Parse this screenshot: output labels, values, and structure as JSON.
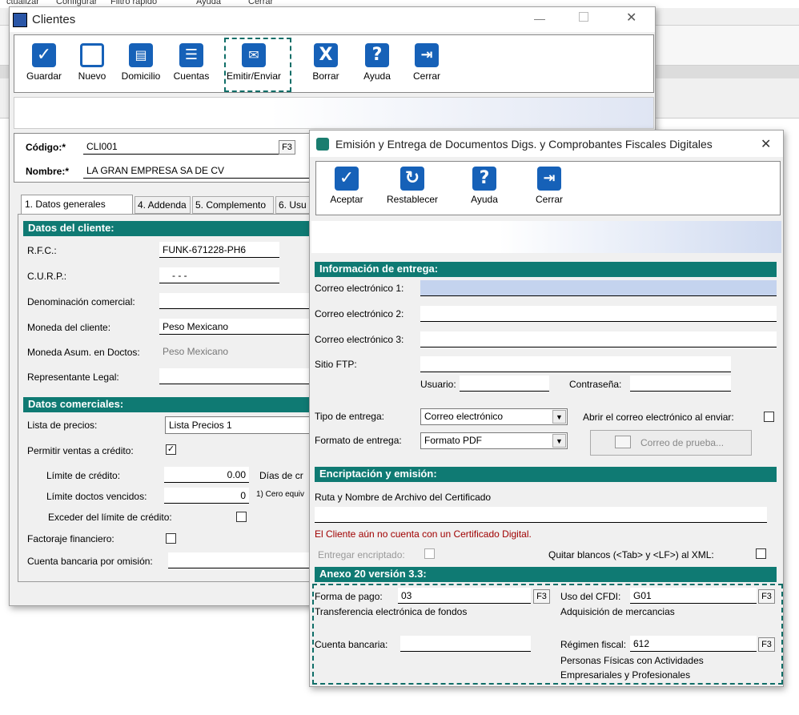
{
  "background": {
    "menu": [
      "ctualizar",
      "Configurar",
      "Filtro rápido",
      "Ayuda",
      "Cerrar"
    ]
  },
  "clientes": {
    "title": "Clientes",
    "toolbar": {
      "guardar": "Guardar",
      "nuevo": "Nuevo",
      "domicilio": "Domicilio",
      "cuentas": "Cuentas",
      "emitir": "Emitir/Enviar",
      "borrar": "Borrar",
      "ayuda": "Ayuda",
      "cerrar": "Cerrar"
    },
    "codigo_label": "Código:*",
    "codigo_value": "CLI001",
    "nombre_label": "Nombre:*",
    "nombre_value": "LA GRAN EMPRESA SA DE CV",
    "f3": "F3",
    "tabs": [
      "1. Datos generales",
      "4. Addenda",
      "5. Complemento",
      "6. Usu"
    ],
    "datos_cliente": {
      "header": "Datos del cliente:",
      "rfc_label": "R.F.C.:",
      "rfc_value": "FUNK-671228-PH6",
      "curp_label": "C.U.R.P.:",
      "curp_value": "-   -   -",
      "denominacion_label": "Denominación comercial:",
      "moneda_label": "Moneda del cliente:",
      "moneda_value": "Peso Mexicano",
      "moneda_asum_label": "Moneda Asum. en Doctos:",
      "moneda_asum_value": "Peso Mexicano",
      "representante_label": "Representante Legal:"
    },
    "datos_comerciales": {
      "header": "Datos comerciales:",
      "lista_label": "Lista de precios:",
      "lista_value": "Lista Precios 1",
      "permitir_label": "Permitir ventas a crédito:",
      "permitir_checked": "✓",
      "limite_label": "Límite de crédito:",
      "limite_value": "0.00",
      "dias_label": "Días de cr",
      "limite_doctos_label": "Límite doctos vencidos:",
      "limite_doctos_value": "0",
      "cero_note": "1) Cero equiv",
      "exceder_label": "Exceder del límite de crédito:",
      "factoraje_label": "Factoraje financiero:",
      "cuenta_label": "Cuenta bancaria por omisión:"
    }
  },
  "emision": {
    "title": "Emisión y Entrega de Documentos Digs. y Comprobantes Fiscales Digitales",
    "close": "✕",
    "toolbar": {
      "aceptar": "Aceptar",
      "restablecer": "Restablecer",
      "ayuda": "Ayuda",
      "cerrar": "Cerrar"
    },
    "info_entrega": {
      "header": "Información de entrega:",
      "correo1_label": "Correo electrónico 1:",
      "correo2_label": "Correo electrónico 2:",
      "correo3_label": "Correo electrónico 3:",
      "ftp_label": "Sitio FTP:",
      "usuario_label": "Usuario:",
      "contrasena_label": "Contraseña:",
      "tipo_label": "Tipo de entrega:",
      "tipo_value": "Correo electrónico",
      "abrir_label": "Abrir el correo electrónico al enviar:",
      "formato_label": "Formato de entrega:",
      "formato_value": "Formato PDF",
      "correo_prueba": "Correo de prueba..."
    },
    "encriptacion": {
      "header": "Encriptación y emisión:",
      "ruta_label": "Ruta y Nombre de Archivo del Certificado",
      "warning": "El Cliente aún no cuenta con un Certificado Digital.",
      "entregar_label": "Entregar encriptado:",
      "quitar_label": "Quitar blancos (<Tab> y <LF>) al  XML:"
    },
    "anexo": {
      "header": "Anexo 20 versión 3.3:",
      "forma_pago_label": "Forma de pago:",
      "forma_pago_value": "03",
      "forma_pago_desc": "Transferencia electrónica de fondos",
      "uso_cfdi_label": "Uso del CFDI:",
      "uso_cfdi_value": "G01",
      "uso_cfdi_desc": "Adquisición de mercancias",
      "cuenta_label": "Cuenta bancaria:",
      "regimen_label": "Régimen fiscal:",
      "regimen_value": "612",
      "regimen_desc1": "Personas Físicas con Actividades",
      "regimen_desc2": "Empresariales y Profesionales"
    }
  },
  "colors": {
    "section": "#0f7a73",
    "toolbar_icon": "#1661b8",
    "highlight": "#0f6e68",
    "warning": "#a00000"
  }
}
